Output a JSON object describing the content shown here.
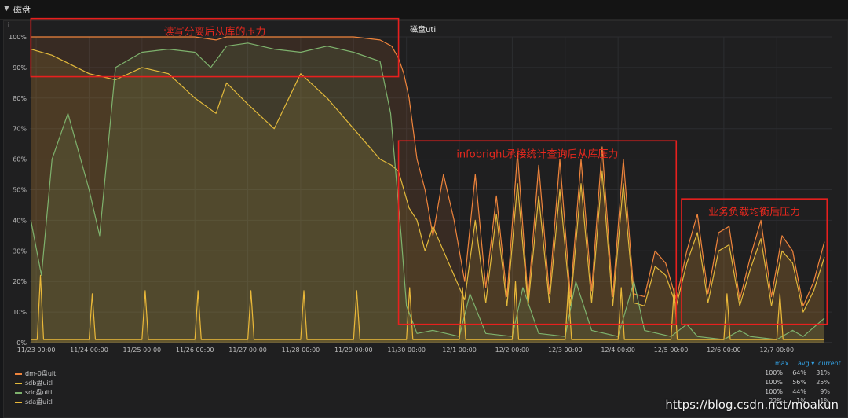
{
  "row": {
    "title": "磁盘"
  },
  "panel": {
    "title": "磁盘util",
    "info": "i"
  },
  "watermark": "https://blog.csdn.net/moakun",
  "chart_data": {
    "type": "line",
    "title": "磁盘util",
    "y_ticks": [
      "0%",
      "10%",
      "20%",
      "30%",
      "40%",
      "50%",
      "60%",
      "70%",
      "80%",
      "90%",
      "100%"
    ],
    "ylim": [
      0,
      100
    ],
    "x_ticks": [
      "11/23 00:00",
      "11/24 00:00",
      "11/25 00:00",
      "11/26 00:00",
      "11/27 00:00",
      "11/28 00:00",
      "11/29 00:00",
      "11/30 00:00",
      "12/1 00:00",
      "12/2 00:00",
      "12/3 00:00",
      "12/4 00:00",
      "12/5 00:00",
      "12/6 00:00",
      "12/7 00:00"
    ],
    "xlim": [
      -0.12,
      15.05
    ],
    "grid": true,
    "series": [
      {
        "name": "dm-0盘uitl",
        "color": "#ef843c",
        "x": [
          -0.1,
          0.3,
          1.0,
          1.5,
          2.0,
          2.5,
          3.0,
          3.4,
          3.6,
          4.0,
          4.5,
          5.0,
          5.5,
          6.0,
          6.5,
          6.72,
          6.85,
          6.95,
          7.05,
          7.2,
          7.35,
          7.5,
          7.7,
          7.9,
          8.1,
          8.3,
          8.5,
          8.7,
          8.9,
          9.1,
          9.3,
          9.5,
          9.7,
          9.9,
          10.1,
          10.3,
          10.5,
          10.7,
          10.9,
          11.1,
          11.3,
          11.5,
          11.7,
          11.9,
          12.1,
          12.3,
          12.5,
          12.7,
          12.9,
          13.1,
          13.3,
          13.5,
          13.7,
          13.9,
          14.1,
          14.3,
          14.5,
          14.7,
          14.9
        ],
        "y": [
          100,
          100,
          100,
          100,
          100,
          100,
          100,
          99,
          100,
          100,
          100,
          100,
          100,
          100,
          99,
          97,
          93,
          88,
          80,
          60,
          50,
          35,
          55,
          40,
          20,
          55,
          18,
          48,
          15,
          62,
          14,
          58,
          16,
          60,
          15,
          60,
          17,
          64,
          15,
          60,
          16,
          15,
          30,
          26,
          14,
          30,
          42,
          16,
          36,
          38,
          14,
          28,
          40,
          15,
          35,
          30,
          12,
          20,
          33
        ]
      },
      {
        "name": "sdb盘uitl",
        "color": "#e2b93b",
        "x": [
          -0.1,
          0.3,
          1.0,
          1.5,
          2.0,
          2.5,
          3.0,
          3.4,
          3.6,
          4.0,
          4.5,
          5.0,
          5.5,
          6.0,
          6.5,
          6.72,
          6.85,
          6.95,
          7.05,
          7.2,
          7.35,
          7.5,
          7.7,
          7.9,
          8.1,
          8.3,
          8.5,
          8.7,
          8.9,
          9.1,
          9.3,
          9.5,
          9.7,
          9.9,
          10.1,
          10.3,
          10.5,
          10.7,
          10.9,
          11.1,
          11.3,
          11.5,
          11.7,
          11.9,
          12.1,
          12.3,
          12.5,
          12.7,
          12.9,
          13.1,
          13.3,
          13.5,
          13.7,
          13.9,
          14.1,
          14.3,
          14.5,
          14.7,
          14.9
        ],
        "y": [
          96,
          94,
          88,
          86,
          90,
          88,
          80,
          75,
          85,
          78,
          70,
          88,
          80,
          70,
          60,
          58,
          56,
          50,
          44,
          40,
          30,
          38,
          30,
          22,
          14,
          40,
          13,
          42,
          12,
          52,
          12,
          48,
          13,
          50,
          12,
          52,
          13,
          56,
          12,
          52,
          13,
          12,
          25,
          22,
          12,
          26,
          36,
          13,
          30,
          32,
          12,
          24,
          34,
          12,
          30,
          26,
          10,
          17,
          28
        ]
      },
      {
        "name": "sdc盘uitl",
        "color": "#7eb26d",
        "x": [
          -0.1,
          0.1,
          0.3,
          0.6,
          1.0,
          1.2,
          1.5,
          2.0,
          2.5,
          3.0,
          3.3,
          3.6,
          4.0,
          4.5,
          5.0,
          5.5,
          6.0,
          6.5,
          6.7,
          6.9,
          7.0,
          7.2,
          7.5,
          8.0,
          8.2,
          8.5,
          9.0,
          9.2,
          9.5,
          10.0,
          10.2,
          10.5,
          11.0,
          11.3,
          11.5,
          12.0,
          12.3,
          12.5,
          13.0,
          13.3,
          13.5,
          14.0,
          14.3,
          14.5,
          14.9
        ],
        "y": [
          40,
          22,
          60,
          75,
          50,
          35,
          90,
          95,
          96,
          95,
          90,
          97,
          98,
          96,
          95,
          97,
          95,
          92,
          75,
          35,
          12,
          3,
          4,
          2,
          16,
          3,
          2,
          18,
          3,
          2,
          20,
          4,
          2,
          20,
          4,
          2,
          6,
          2,
          1,
          4,
          2,
          1,
          4,
          2,
          8
        ]
      },
      {
        "name": "sda盘uitl",
        "color": "#eab839",
        "x": [
          -0.1,
          0.02,
          0.08,
          0.14,
          1.0,
          1.06,
          1.12,
          2.0,
          2.06,
          2.12,
          3.0,
          3.06,
          3.12,
          4.0,
          4.06,
          4.12,
          5.0,
          5.06,
          5.12,
          6.0,
          6.06,
          6.12,
          7.0,
          7.06,
          7.12,
          8.0,
          8.06,
          8.12,
          9.0,
          9.06,
          9.12,
          10.0,
          10.06,
          10.12,
          11.0,
          11.06,
          11.12,
          12.0,
          12.06,
          12.12,
          13.0,
          13.06,
          13.12,
          14.0,
          14.06,
          14.12,
          14.9
        ],
        "y": [
          1,
          1,
          22,
          1,
          1,
          16,
          1,
          1,
          17,
          1,
          1,
          17,
          1,
          1,
          17,
          1,
          1,
          17,
          1,
          1,
          17,
          1,
          1,
          18,
          1,
          1,
          18,
          1,
          1,
          20,
          1,
          1,
          18,
          1,
          1,
          18,
          1,
          1,
          18,
          1,
          1,
          16,
          1,
          1,
          16,
          1,
          1
        ]
      }
    ],
    "annotations": [
      {
        "text": "读写分离后从库的压力",
        "x0": -0.1,
        "x1": 6.85,
        "y0": 87,
        "y1": 106
      },
      {
        "text": "infobright承接统计查询后从库压力",
        "x0": 6.85,
        "x1": 12.1,
        "y0": 6,
        "y1": 66
      },
      {
        "text": "业务负载均衡后压力",
        "x0": 12.2,
        "x1": 14.95,
        "y0": 6,
        "y1": 47
      }
    ],
    "legend": {
      "position": "bottom-left",
      "columns": [
        "max",
        "avg ▾",
        "current"
      ],
      "rows": [
        {
          "name": "dm-0盘uitl",
          "color": "#ef843c",
          "max": "100%",
          "avg": "64%",
          "current": "31%"
        },
        {
          "name": "sdb盘uitl",
          "color": "#e2b93b",
          "max": "100%",
          "avg": "56%",
          "current": "25%"
        },
        {
          "name": "sdc盘uitl",
          "color": "#7eb26d",
          "max": "100%",
          "avg": "44%",
          "current": "9%"
        },
        {
          "name": "sda盘uitl",
          "color": "#eab839",
          "max": "22%",
          "avg": "1%",
          "current": "1%"
        }
      ]
    }
  }
}
